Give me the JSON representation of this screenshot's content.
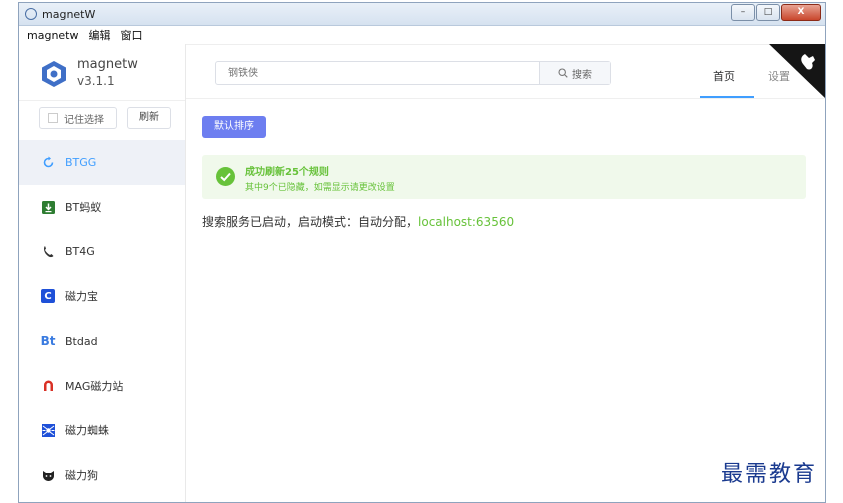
{
  "window": {
    "title": "magnetW",
    "minimize": "–",
    "maximize": "□",
    "close": "X"
  },
  "menu": [
    "magnetw",
    "编辑",
    "窗口"
  ],
  "app": {
    "name": "magnetw",
    "version": "v3.1.1"
  },
  "sidebar": {
    "remember_label": "记住选择",
    "refresh_label": "刷新",
    "items": [
      {
        "label": "BTGG",
        "icon": "refresh-circle-icon",
        "icon_text": "",
        "icon_color": "#409eff"
      },
      {
        "label": "BT蚂蚁",
        "icon": "download-box-icon",
        "icon_text": "",
        "icon_color": "#2e7d32"
      },
      {
        "label": "BT4G",
        "icon": "phone-handset-icon",
        "icon_text": "",
        "icon_color": "#333333"
      },
      {
        "label": "磁力宝",
        "icon": "c-letter-icon",
        "icon_text": "C",
        "icon_color": "#1e50d8"
      },
      {
        "label": "Btdad",
        "icon": "bt-letters-icon",
        "icon_text": "Bt",
        "icon_color": "#3a7be0"
      },
      {
        "label": "MAG磁力站",
        "icon": "magnet-icon",
        "icon_text": "",
        "icon_color": "#d93025"
      },
      {
        "label": "磁力蜘蛛",
        "icon": "spider-icon",
        "icon_text": "",
        "icon_color": "#1e50d8"
      },
      {
        "label": "磁力狗",
        "icon": "dog-icon",
        "icon_text": "",
        "icon_color": "#222222"
      }
    ]
  },
  "header": {
    "search_placeholder": "钢铁侠",
    "search_button": "搜索",
    "tabs": [
      {
        "label": "首页",
        "active": true
      },
      {
        "label": "设置",
        "active": false
      }
    ]
  },
  "main": {
    "sort_button": "默认排序",
    "alert_title": "成功刷新25个规则",
    "alert_desc": "其中9个已隐藏，如需显示请更改设置",
    "status_prefix": "搜索服务已启动，启动模式：自动分配，",
    "status_host": "localhost:63560"
  },
  "watermark": "最需教育",
  "colors": {
    "accent": "#409eff",
    "success": "#67c23a",
    "sort_button": "#6d7ef0"
  }
}
